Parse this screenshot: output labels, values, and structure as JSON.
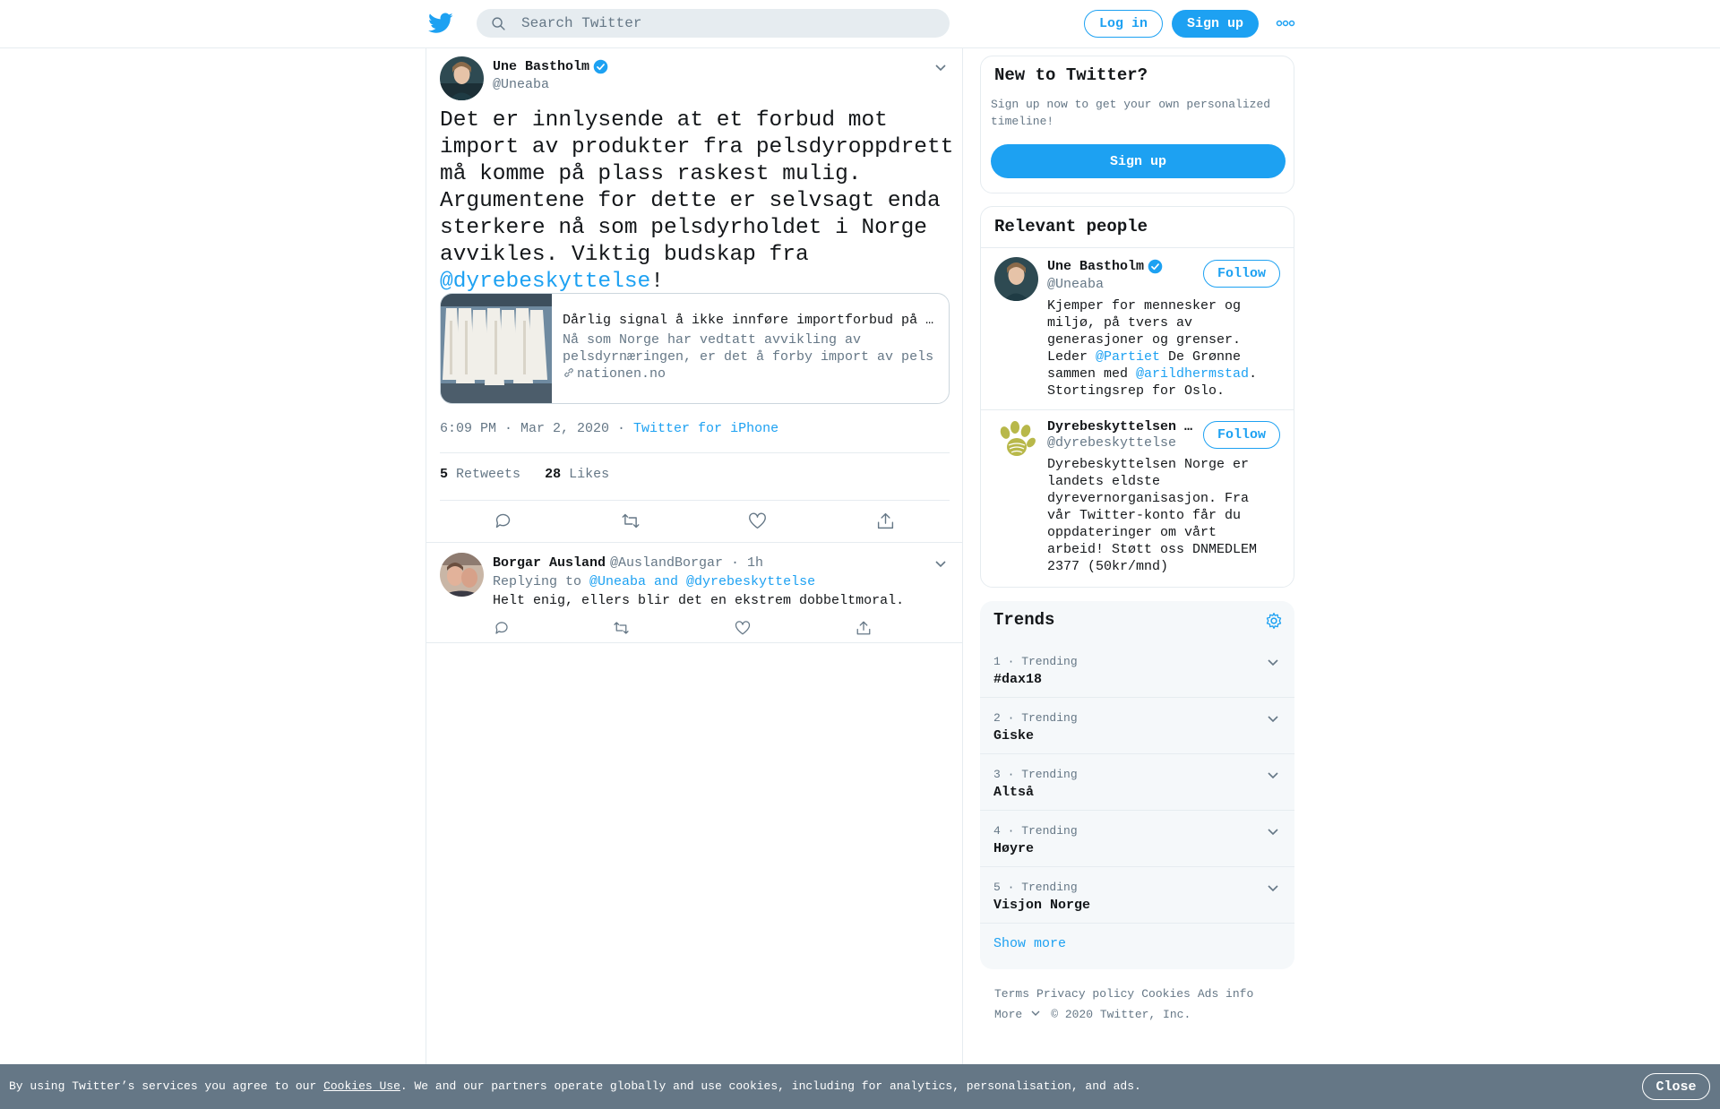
{
  "header": {
    "search_placeholder": "Search Twitter",
    "login_label": "Log in",
    "signup_label": "Sign up"
  },
  "tweet": {
    "author_name": "Une Bastholm",
    "author_handle": "@Uneaba",
    "text_before": "Det er innlysende at et forbud mot import av produkter fra pelsdyroppdrett må komme på plass raskest mulig. Argumentene for dette er selvsagt enda sterkere nå som pelsdyrholdet i Norge avvikles. Viktig budskap fra ",
    "text_mention": "@dyrebeskyttelse",
    "text_after": "!",
    "card": {
      "title": "Dårlig signal å ikke innføre importforbud på pels",
      "desc_line1": "Nå som Norge har vedtatt avvikling av",
      "desc_line2": "pelsdyrnæringen, er det å forby import av pels",
      "domain": "nationen.no"
    },
    "time": "6:09 PM · Mar 2, 2020",
    "dot": " · ",
    "source": "Twitter for iPhone",
    "retweets_count": "5",
    "retweets_label": "Retweets",
    "likes_count": "28",
    "likes_label": "Likes"
  },
  "reply": {
    "name": "Borgar Ausland",
    "handle_time": "@AuslandBorgar · 1h",
    "replying_prefix": "Replying to ",
    "replying_users": "@Uneaba and @dyrebeskyttelse",
    "text": "Helt enig, ellers blir det en ekstrem dobbeltmoral."
  },
  "sidebar": {
    "new_title": "New to Twitter?",
    "new_sub": "Sign up now to get your own personalized timeline!",
    "signup_label": "Sign up",
    "people_title": "Relevant people",
    "people": [
      {
        "name": "Une Bastholm",
        "handle": "@Uneaba",
        "follow_label": "Follow",
        "bio_1": "Kjemper for mennesker og miljø, på tvers av generasjoner og grenser. Leder ",
        "bio_link1": "@Partiet",
        "bio_2": " De Grønne sammen med ",
        "bio_link2": "@arildhermstad",
        "bio_3": ". Stortingsrep for Oslo."
      },
      {
        "name": "Dyrebeskyttelsen Norge",
        "handle": "@dyrebeskyttelse",
        "follow_label": "Follow",
        "bio": "Dyrebeskyttelsen Norge er landets eldste dyrevernorganisasjon. Fra vår Twitter-konto får du oppdateringer om vårt arbeid! Støtt oss DNMEDLEM 2377 (50kr/mnd)"
      }
    ],
    "trends_title": "Trends",
    "trends": [
      {
        "meta": "1 · Trending",
        "name": "#dax18"
      },
      {
        "meta": "2 · Trending",
        "name": "Giske"
      },
      {
        "meta": "3 · Trending",
        "name": "Altså"
      },
      {
        "meta": "4 · Trending",
        "name": "Høyre"
      },
      {
        "meta": "5 · Trending",
        "name": "Visjon Norge"
      }
    ],
    "show_more": "Show more"
  },
  "footer": {
    "terms": "Terms",
    "privacy": "Privacy policy",
    "cookies": "Cookies",
    "ads": "Ads info",
    "more": "More",
    "copyright": "© 2020 Twitter, Inc."
  },
  "cookie_bar": {
    "text_before": "By using Twitter’s services you agree to our ",
    "link": "Cookies Use",
    "text_after": ". We and our partners operate globally and use cookies, including for analytics, personalisation, and ads.",
    "close_label": "Close"
  },
  "colors": {
    "accent": "#1da1f2",
    "secondary_text": "#657786",
    "border": "#e6ecf0",
    "cookie_bg": "#657786"
  }
}
